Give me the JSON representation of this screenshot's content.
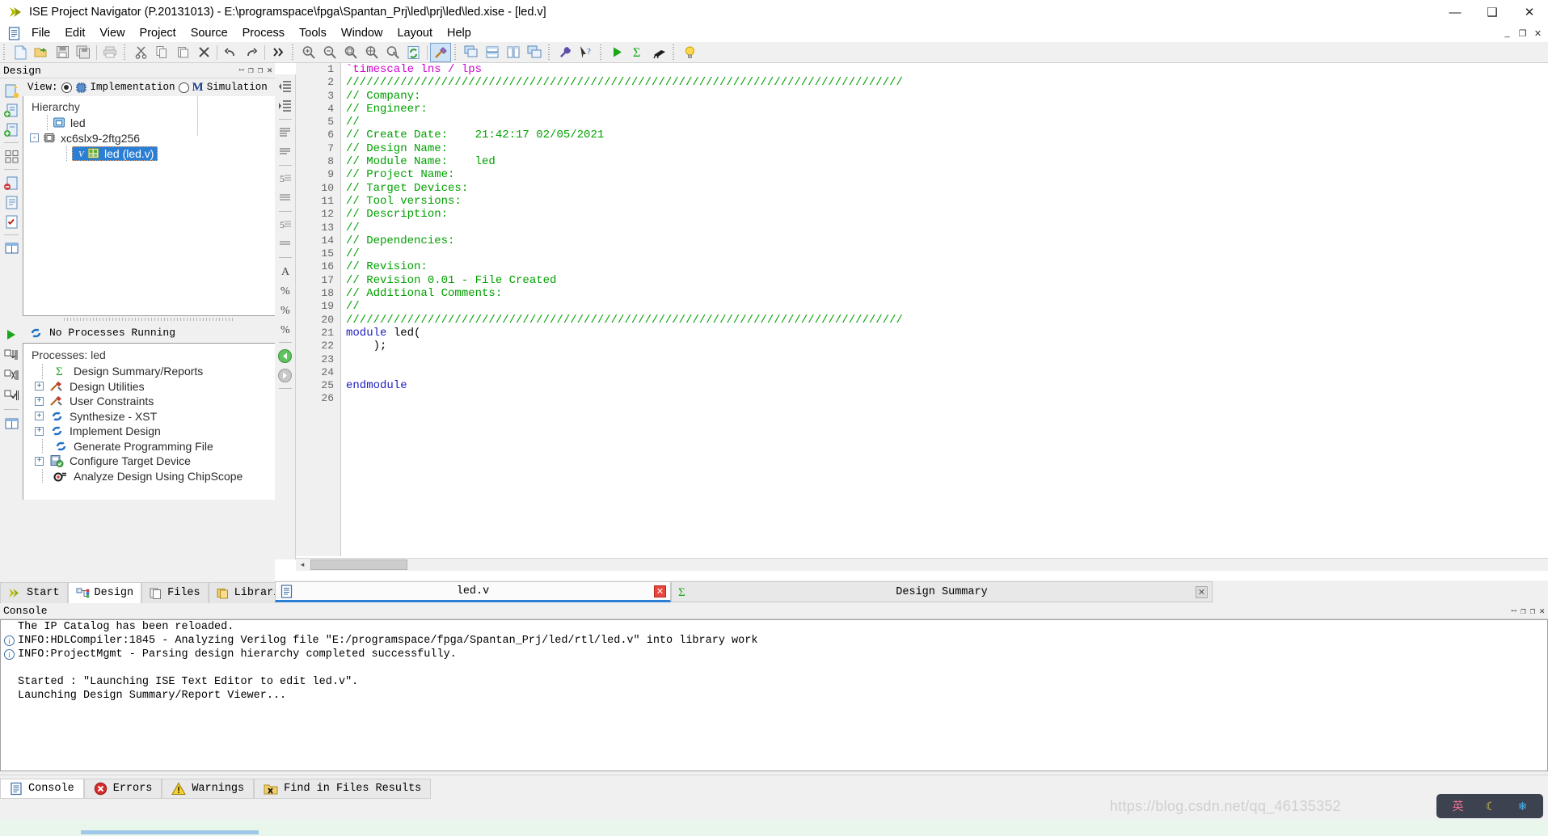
{
  "window": {
    "title": "ISE Project Navigator (P.20131013) - E:\\programspace\\fpga\\Spantan_Prj\\led\\prj\\led\\led.xise - [led.v]",
    "app_icon": "ise-chevron-icon",
    "minimize": "—",
    "maximize": "❑",
    "close": "✕",
    "mdi_minimize": "_",
    "mdi_restore": "❐",
    "mdi_close": "✕"
  },
  "menubar": {
    "doc_icon": "document-icon",
    "items": [
      {
        "label": "File"
      },
      {
        "label": "Edit"
      },
      {
        "label": "View"
      },
      {
        "label": "Project"
      },
      {
        "label": "Source"
      },
      {
        "label": "Process"
      },
      {
        "label": "Tools"
      },
      {
        "label": "Window"
      },
      {
        "label": "Layout"
      },
      {
        "label": "Help"
      }
    ]
  },
  "toolbar": {
    "groups": [
      {
        "buttons": [
          {
            "name": "new-file-icon",
            "tip": "New"
          },
          {
            "name": "open-file-icon",
            "tip": "Open"
          },
          {
            "name": "save-icon",
            "tip": "Save"
          },
          {
            "name": "save-all-icon",
            "tip": "Save All"
          },
          {
            "name": "print-icon",
            "tip": "Print"
          }
        ]
      },
      {
        "buttons": [
          {
            "name": "cut-icon",
            "tip": "Cut"
          },
          {
            "name": "copy-icon",
            "tip": "Copy"
          },
          {
            "name": "paste-icon",
            "tip": "Paste"
          },
          {
            "name": "delete-icon",
            "tip": "Delete"
          },
          {
            "name": "undo-icon",
            "tip": "Undo"
          },
          {
            "name": "redo-icon",
            "tip": "Redo"
          },
          {
            "name": "overflow-chevrons-icon",
            "tip": "More"
          }
        ]
      },
      {
        "buttons": [
          {
            "name": "zoom-in-icon",
            "tip": "Zoom In"
          },
          {
            "name": "zoom-out-icon",
            "tip": "Zoom Out"
          },
          {
            "name": "zoom-fit-icon",
            "tip": "Zoom To Fit"
          },
          {
            "name": "zoom-selection-icon",
            "tip": "Zoom Selection"
          },
          {
            "name": "zoom-region-icon",
            "tip": "Zoom Region"
          },
          {
            "name": "refresh-document-icon",
            "tip": "Refresh"
          },
          {
            "name": "hammer-wand-icon",
            "tip": "Build"
          }
        ]
      },
      {
        "buttons": [
          {
            "name": "cascade-windows-icon",
            "tip": "Cascade"
          },
          {
            "name": "tile-horizontal-icon",
            "tip": "Tile Horizontally"
          },
          {
            "name": "tile-vertical-icon",
            "tip": "Tile Vertically"
          },
          {
            "name": "new-window-icon",
            "tip": "New Window"
          }
        ]
      },
      {
        "buttons": [
          {
            "name": "wrench-icon",
            "tip": "Preferences"
          },
          {
            "name": "context-help-icon",
            "tip": "Context Help"
          }
        ]
      },
      {
        "buttons": [
          {
            "name": "run-icon",
            "tip": "Run"
          },
          {
            "name": "sigma-report-icon",
            "tip": "Design Summary"
          },
          {
            "name": "telescope-icon",
            "tip": "Planahead"
          }
        ]
      },
      {
        "buttons": [
          {
            "name": "lightbulb-icon",
            "tip": "Tip of the Day"
          }
        ]
      }
    ]
  },
  "design_panel": {
    "header_title": "Design",
    "header_buttons": [
      "↔",
      "❐",
      "❐",
      "✕"
    ],
    "view_label": "View:",
    "view_options": [
      {
        "label": "Implementation",
        "selected": true,
        "icon": "chip-icon"
      },
      {
        "label": "Simulation",
        "selected": false,
        "icon": "m-letter-icon"
      }
    ],
    "vtoolbar": [
      "new-source-icon",
      "add-source-icon",
      "add-copy-source-icon",
      "manage-configurations-icon",
      "remove-source-icon",
      "design-properties-icon",
      "design-goals-icon",
      "view-panel-icon"
    ],
    "hierarchy": {
      "title": "Hierarchy",
      "nodes": [
        {
          "label": "led",
          "icon": "project-folder-icon",
          "depth": 1,
          "expander": null,
          "selected": false
        },
        {
          "label": "xc6slx9-2ftg256",
          "icon": "device-chip-icon",
          "depth": 1,
          "expander": "-",
          "selected": false
        },
        {
          "label": "led (led.v)",
          "icon": "verilog-module-icon",
          "depth": 2,
          "expander": null,
          "selected": true
        }
      ]
    },
    "processes": {
      "status_text": "No Processes Running",
      "status_icon": "refresh-blue-icon",
      "title_prefix": "Processes: ",
      "title_target": "led",
      "items": [
        {
          "label": "Design Summary/Reports",
          "icon": "sigma-green-icon",
          "expander": null
        },
        {
          "label": "Design Utilities",
          "icon": "hammer-wrench-icon",
          "expander": "+"
        },
        {
          "label": "User Constraints",
          "icon": "hammer-wrench-icon",
          "expander": "+"
        },
        {
          "label": "Synthesize - XST",
          "icon": "refresh-blue-icon",
          "expander": "+"
        },
        {
          "label": "Implement Design",
          "icon": "refresh-blue-icon",
          "expander": "+"
        },
        {
          "label": "Generate Programming File",
          "icon": "refresh-blue-icon",
          "expander": null
        },
        {
          "label": "Configure Target Device",
          "icon": "configure-device-icon",
          "expander": "+"
        },
        {
          "label": "Analyze Design Using ChipScope",
          "icon": "chipscope-icon",
          "expander": null
        }
      ]
    },
    "vtoolbar_processes": [
      "run-green-icon",
      "rerun-icon",
      "rerun-all-icon",
      "stop-icon",
      "view-panel-icon"
    ]
  },
  "dock_tabs": [
    {
      "label": "Start",
      "icon": "start-chevron-icon",
      "selected": false
    },
    {
      "label": "Design",
      "icon": "design-tree-icon",
      "selected": true
    },
    {
      "label": "Files",
      "icon": "files-icon",
      "selected": false
    },
    {
      "label": "Libraries",
      "icon": "libraries-icon",
      "selected": false
    }
  ],
  "editor": {
    "vtoolbar": [
      "decrease-indent-icon",
      "increase-indent-icon",
      "toggle-comment-icon",
      "uncomment-icon",
      "bookmark-toggle-icon",
      "bookmark-clear-icon",
      "find-icon",
      "find-next-icon",
      "find-prev-icon",
      "find-all-icon",
      "back-icon",
      "forward-icon"
    ],
    "scroll": {
      "left_arrow": "◂",
      "right_arrow": "▸"
    },
    "lines": [
      {
        "n": 1,
        "tokens": [
          {
            "t": "`timescale lns / lps",
            "c": "c-directive"
          }
        ]
      },
      {
        "n": 2,
        "tokens": [
          {
            "t": "//////////////////////////////////////////////////////////////////////////////////",
            "c": "c-comment"
          }
        ]
      },
      {
        "n": 3,
        "tokens": [
          {
            "t": "// Company:",
            "c": "c-comment"
          }
        ]
      },
      {
        "n": 4,
        "tokens": [
          {
            "t": "// Engineer:",
            "c": "c-comment"
          }
        ]
      },
      {
        "n": 5,
        "tokens": [
          {
            "t": "//",
            "c": "c-comment"
          }
        ]
      },
      {
        "n": 6,
        "tokens": [
          {
            "t": "// Create Date:    21:42:17 02/05/2021",
            "c": "c-comment"
          }
        ]
      },
      {
        "n": 7,
        "tokens": [
          {
            "t": "// Design Name:",
            "c": "c-comment"
          }
        ]
      },
      {
        "n": 8,
        "tokens": [
          {
            "t": "// Module Name:    led",
            "c": "c-comment"
          }
        ]
      },
      {
        "n": 9,
        "tokens": [
          {
            "t": "// Project Name:",
            "c": "c-comment"
          }
        ]
      },
      {
        "n": 10,
        "tokens": [
          {
            "t": "// Target Devices:",
            "c": "c-comment"
          }
        ]
      },
      {
        "n": 11,
        "tokens": [
          {
            "t": "// Tool versions:",
            "c": "c-comment"
          }
        ]
      },
      {
        "n": 12,
        "tokens": [
          {
            "t": "// Description:",
            "c": "c-comment"
          }
        ]
      },
      {
        "n": 13,
        "tokens": [
          {
            "t": "//",
            "c": "c-comment"
          }
        ]
      },
      {
        "n": 14,
        "tokens": [
          {
            "t": "// Dependencies:",
            "c": "c-comment"
          }
        ]
      },
      {
        "n": 15,
        "tokens": [
          {
            "t": "//",
            "c": "c-comment"
          }
        ]
      },
      {
        "n": 16,
        "tokens": [
          {
            "t": "// Revision:",
            "c": "c-comment"
          }
        ]
      },
      {
        "n": 17,
        "tokens": [
          {
            "t": "// Revision 0.01 - File Created",
            "c": "c-comment"
          }
        ]
      },
      {
        "n": 18,
        "tokens": [
          {
            "t": "// Additional Comments:",
            "c": "c-comment"
          }
        ]
      },
      {
        "n": 19,
        "tokens": [
          {
            "t": "//",
            "c": "c-comment"
          }
        ]
      },
      {
        "n": 20,
        "tokens": [
          {
            "t": "//////////////////////////////////////////////////////////////////////////////////",
            "c": "c-comment"
          }
        ]
      },
      {
        "n": 21,
        "tokens": [
          {
            "t": "module",
            "c": "c-kw"
          },
          {
            "t": " led(",
            "c": "c-plain"
          }
        ]
      },
      {
        "n": 22,
        "tokens": [
          {
            "t": "    );",
            "c": "c-plain"
          }
        ]
      },
      {
        "n": 23,
        "tokens": [
          {
            "t": "",
            "c": "c-plain"
          }
        ]
      },
      {
        "n": 24,
        "tokens": [
          {
            "t": "",
            "c": "c-plain"
          }
        ]
      },
      {
        "n": 25,
        "tokens": [
          {
            "t": "endmodule",
            "c": "c-kw"
          }
        ]
      },
      {
        "n": 26,
        "tokens": [
          {
            "t": "",
            "c": "c-plain"
          }
        ]
      }
    ]
  },
  "file_tabs": [
    {
      "label": "led.v",
      "icon": "verilog-file-icon",
      "selected": true,
      "close": "✕"
    },
    {
      "label": "Design Summary",
      "icon": "sigma-green-icon",
      "selected": false,
      "close": "✕"
    }
  ],
  "console": {
    "header_title": "Console",
    "header_buttons": [
      "↔",
      "❐",
      "❐",
      "✕"
    ],
    "lines": [
      {
        "badge": false,
        "text": "The IP Catalog has been reloaded."
      },
      {
        "badge": true,
        "text": "INFO:HDLCompiler:1845 - Analyzing Verilog file \"E:/programspace/fpga/Spantan_Prj/led/rtl/led.v\" into library work"
      },
      {
        "badge": true,
        "text": "INFO:ProjectMgmt - Parsing design hierarchy completed successfully."
      },
      {
        "badge": false,
        "text": ""
      },
      {
        "badge": false,
        "text": "Started : \"Launching ISE Text Editor to edit led.v\"."
      },
      {
        "badge": false,
        "text": "Launching Design Summary/Report Viewer..."
      }
    ],
    "scroll": {
      "left_arrow": "◂",
      "right_arrow": "▸"
    }
  },
  "status_tabs": [
    {
      "label": "Console",
      "icon": "console-icon",
      "selected": true
    },
    {
      "label": "Errors",
      "icon": "error-icon",
      "selected": false
    },
    {
      "label": "Warnings",
      "icon": "warning-icon",
      "selected": false
    },
    {
      "label": "Find in Files Results",
      "icon": "find-files-icon",
      "selected": false
    }
  ],
  "overlay": {
    "watermark": "https://blog.csdn.net/qq_46135352",
    "ime_icons": [
      "chinese-char-icon",
      "moon-icon",
      "flower-icon"
    ]
  },
  "colors": {
    "accent": "#2a7fd4",
    "comment_green": "#00a000",
    "directive_magenta": "#d000d0",
    "keyword_blue": "#2020c0",
    "selection_blue": "#2a7fd4",
    "error_red": "#e8453c",
    "chrome_gray": "#f0f0f0"
  }
}
